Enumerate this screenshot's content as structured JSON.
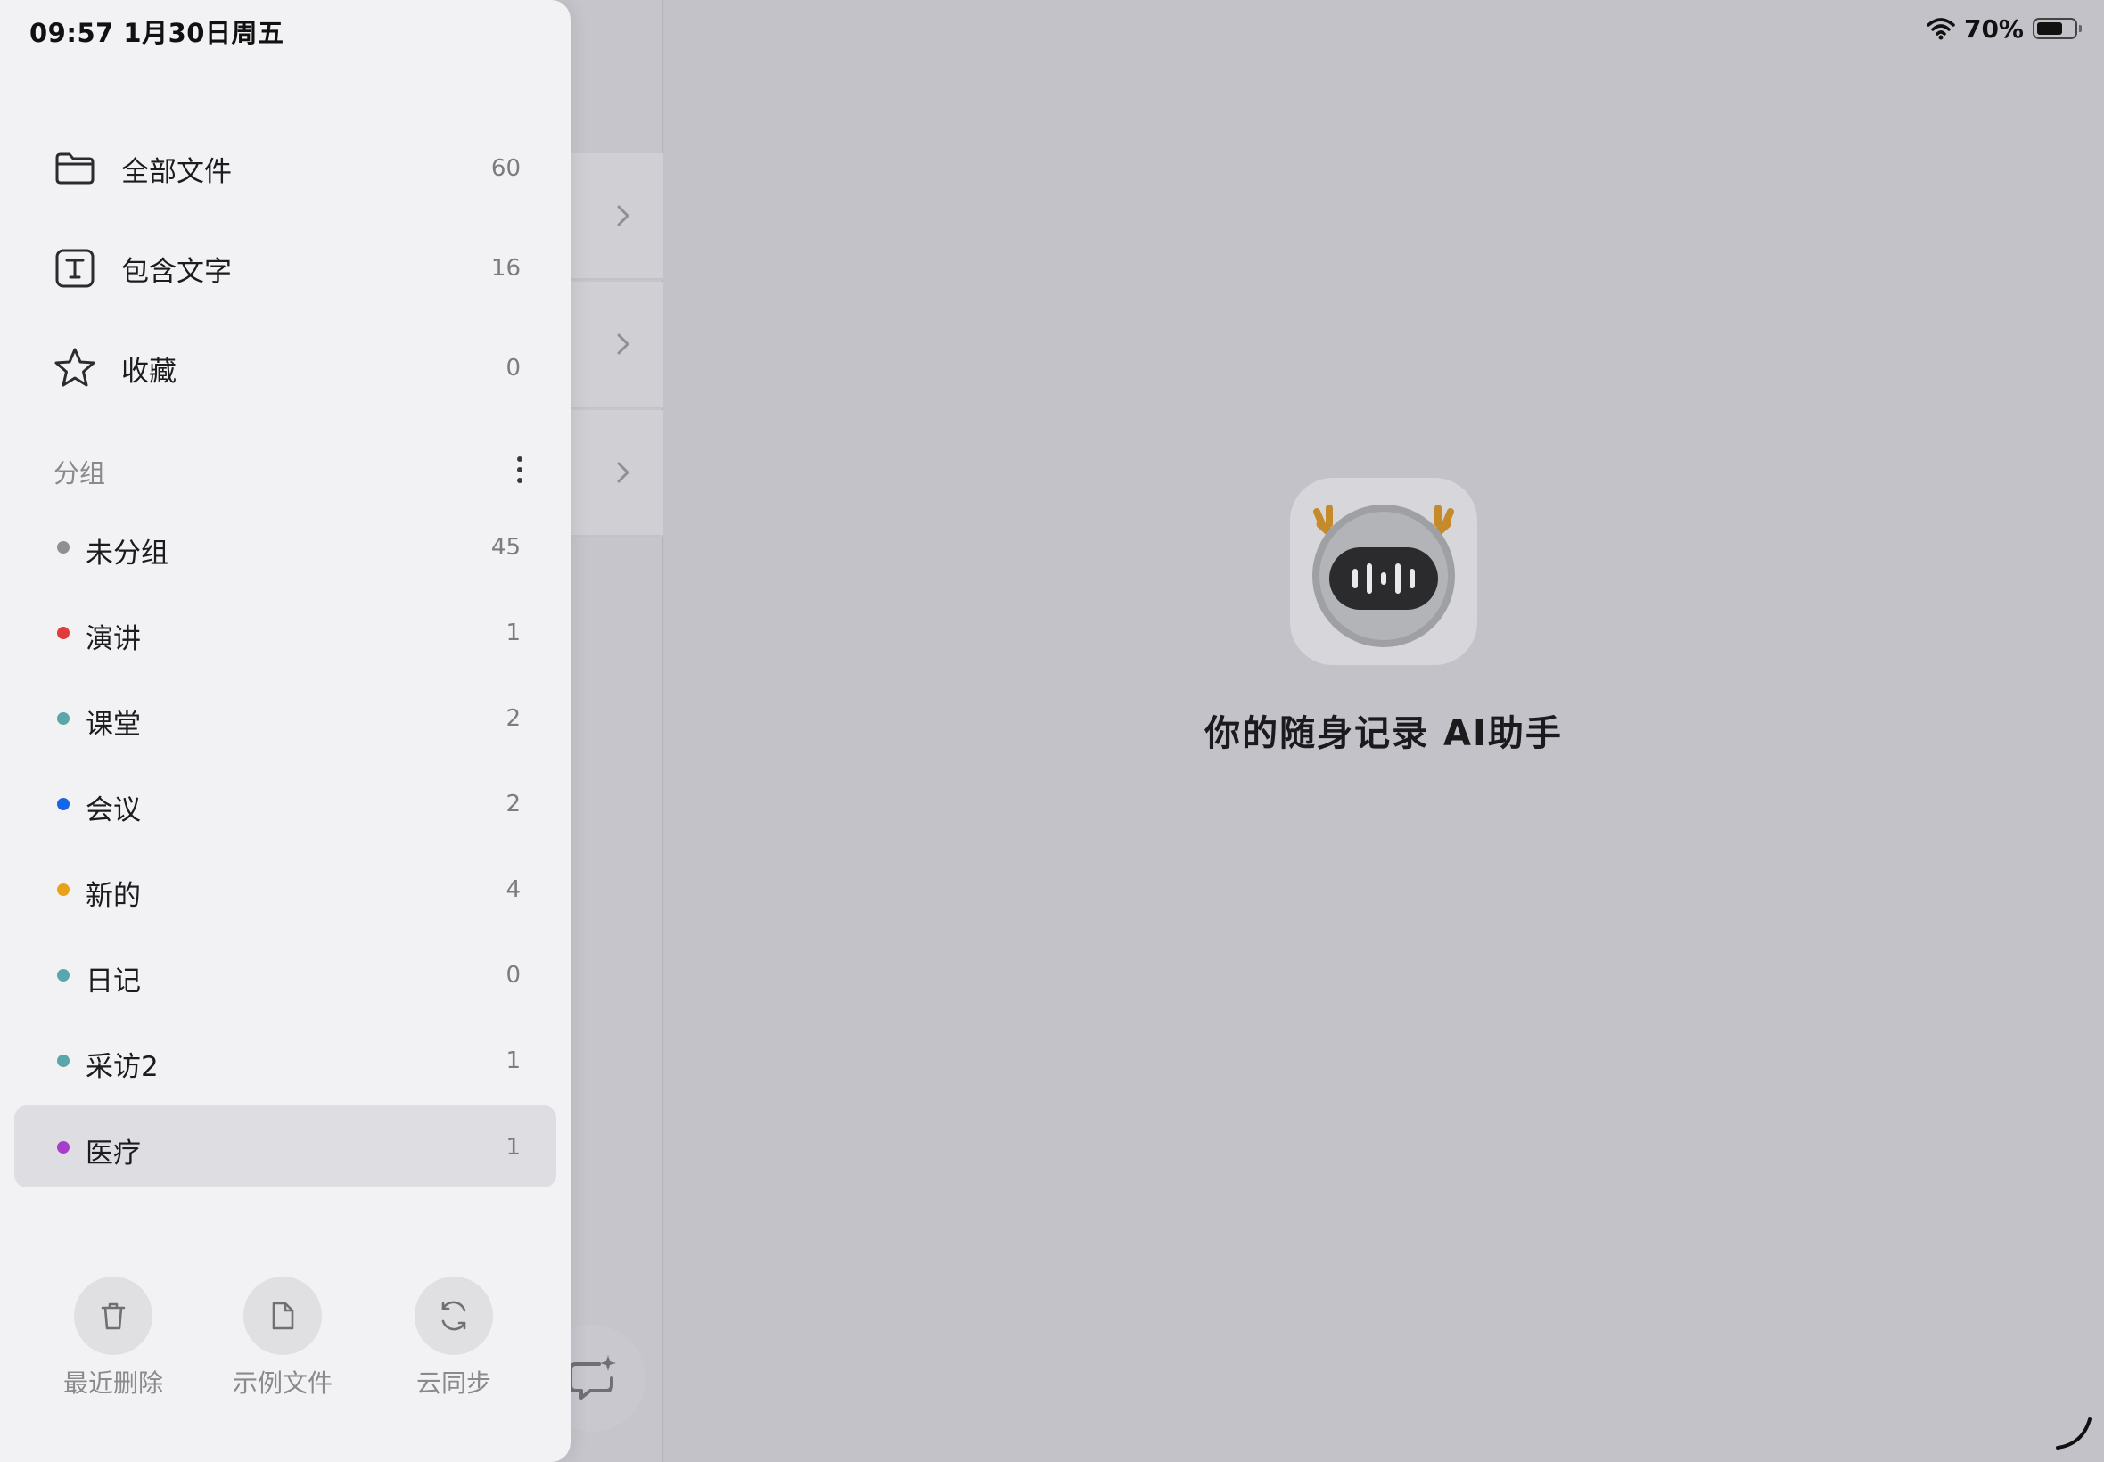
{
  "status_bar": {
    "time_date": "09:57   1月30日周五",
    "battery_percent": "70%",
    "battery_level": 0.7
  },
  "main": {
    "tagline": "你的随身记录 AI助手",
    "logo_icon": "robot-deer-icon"
  },
  "drawer": {
    "nav_items": [
      {
        "label": "全部文件",
        "count": "60",
        "icon": "folder-icon"
      },
      {
        "label": "包含文字",
        "count": "16",
        "icon": "text-t-icon"
      },
      {
        "label": "收藏",
        "count": "0",
        "icon": "star-icon"
      }
    ],
    "groups_title": "分组",
    "groups": [
      {
        "label": "未分组",
        "count": "45",
        "color": "#8e8e93",
        "active": false
      },
      {
        "label": "演讲",
        "count": "1",
        "color": "#e03c3c",
        "active": false
      },
      {
        "label": "课堂",
        "count": "2",
        "color": "#5aa7a9",
        "active": false
      },
      {
        "label": "会议",
        "count": "2",
        "color": "#1566e6",
        "active": false
      },
      {
        "label": "新的",
        "count": "4",
        "color": "#e7a11a",
        "active": false
      },
      {
        "label": "日记",
        "count": "0",
        "color": "#5aa7a9",
        "active": false
      },
      {
        "label": "采访2",
        "count": "1",
        "color": "#5aa7a9",
        "active": false
      },
      {
        "label": "医疗",
        "count": "1",
        "color": "#a63fc8",
        "active": true
      }
    ],
    "bottom_actions": [
      {
        "label": "最近删除",
        "icon": "trash-icon"
      },
      {
        "label": "示例文件",
        "icon": "document-icon"
      },
      {
        "label": "云同步",
        "icon": "sync-icon"
      }
    ]
  }
}
